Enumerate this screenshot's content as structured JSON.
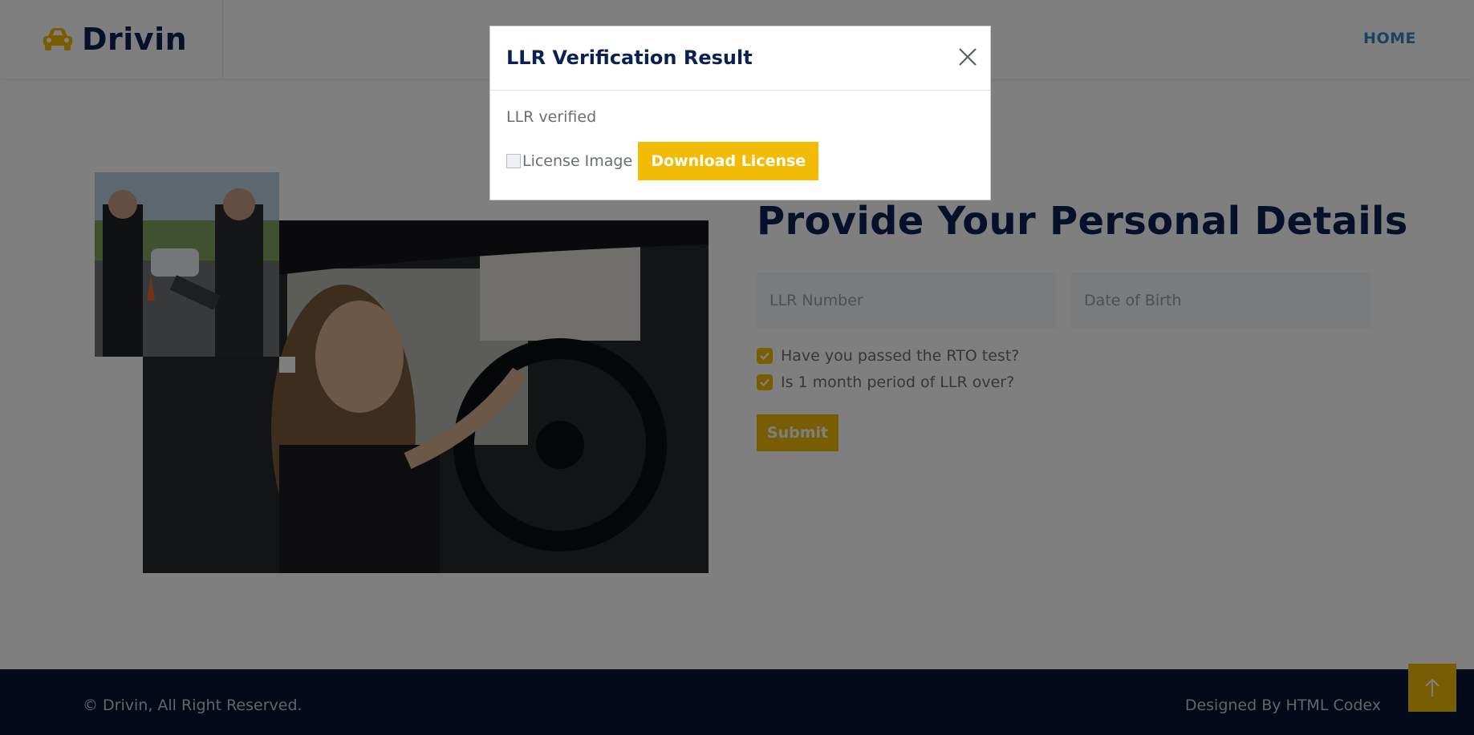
{
  "brand": {
    "name": "Drivin",
    "icon": "car-icon"
  },
  "nav": {
    "home_label": "HOME"
  },
  "form": {
    "title": "Provide Your Personal Details",
    "llr_placeholder": "LLR Number",
    "dob_placeholder": "Date of Birth",
    "check_rto": "Have you passed the RTO test?",
    "check_llr_period": "Is 1 month period of LLR over?",
    "submit_label": "Submit"
  },
  "footer": {
    "copyright": "© Drivin, All Right Reserved.",
    "credit": "Designed By HTML Codex"
  },
  "modal": {
    "title": "LLR Verification Result",
    "message": "LLR verified",
    "image_alt": "License Image",
    "download_label": "Download License"
  },
  "colors": {
    "accent": "#f2bb05",
    "navy": "#0b2154",
    "footer": "#051432",
    "link": "#2f86c8"
  }
}
